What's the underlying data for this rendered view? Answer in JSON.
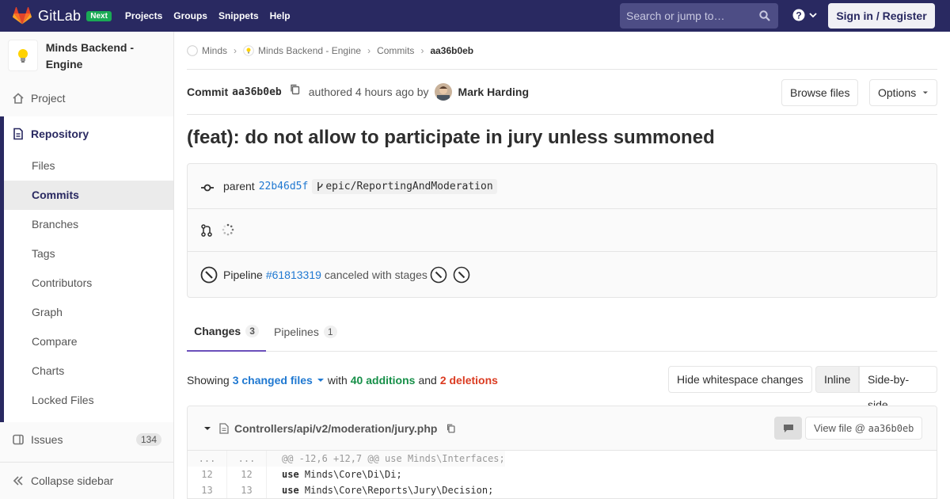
{
  "navbar": {
    "brand": "GitLab",
    "badge": "Next",
    "links": [
      "Projects",
      "Groups",
      "Snippets",
      "Help"
    ],
    "search_placeholder": "Search or jump to…",
    "signin": "Sign in / Register",
    "bg_color": "#292961"
  },
  "sidebar": {
    "project_name": "Minds Backend - Engine",
    "project_label": "Project",
    "repository_label": "Repository",
    "repo_items": [
      "Files",
      "Commits",
      "Branches",
      "Tags",
      "Contributors",
      "Graph",
      "Compare",
      "Charts",
      "Locked Files"
    ],
    "active_item": "Commits",
    "issues_label": "Issues",
    "issues_count": "134",
    "collapse_label": "Collapse sidebar"
  },
  "breadcrumb": [
    "Minds",
    "Minds Backend - Engine",
    "Commits",
    "aa36b0eb"
  ],
  "commit": {
    "label": "Commit",
    "sha": "aa36b0eb",
    "authored": "authored 4 hours ago by",
    "author": "Mark Harding",
    "browse_files": "Browse files",
    "options": "Options",
    "title": "(feat): do not allow to participate in jury unless summoned"
  },
  "info": {
    "parent_label": "parent",
    "parent_sha": "22b46d5f",
    "branch": "epic/ReportingAndModeration",
    "pipeline_label": "Pipeline",
    "pipeline_id": "#61813319",
    "pipeline_status": "canceled with stages"
  },
  "tabs": [
    {
      "label": "Changes",
      "count": "3"
    },
    {
      "label": "Pipelines",
      "count": "1"
    }
  ],
  "diffstat": {
    "showing": "Showing",
    "changed_files": "3 changed files",
    "with": "with",
    "additions": "40 additions",
    "and": "and",
    "deletions": "2 deletions",
    "hide_whitespace": "Hide whitespace changes",
    "inline": "Inline",
    "side_by_side": "Side-by-side"
  },
  "diff_file": {
    "path": "Controllers/api/v2/moderation/jury.php",
    "view_file_label": "View file @",
    "view_file_sha": "aa36b0eb",
    "lines": [
      {
        "old": "...",
        "new": "...",
        "kw": "",
        "code": "@@ -12,6 +12,7 @@ use Minds\\Interfaces;"
      },
      {
        "old": "12",
        "new": "12",
        "kw": "use",
        "code": " Minds\\Core\\Di\\Di;"
      },
      {
        "old": "13",
        "new": "13",
        "kw": "use",
        "code": " Minds\\Core\\Reports\\Jury\\Decision;"
      }
    ]
  },
  "colors": {
    "link": "#1f78d1",
    "additions": "#168f48",
    "deletions": "#db3b21",
    "tab_active": "#6b4fbb"
  }
}
